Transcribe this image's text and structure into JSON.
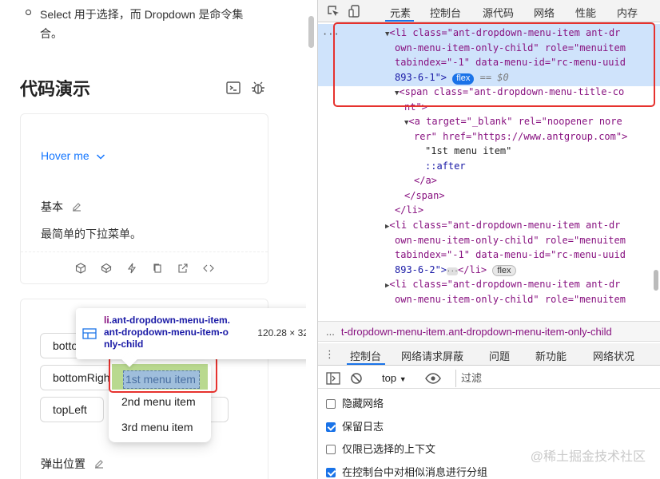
{
  "doc": {
    "bullet_line1": "Select 用于选择，而 Dropdown 是命令集",
    "bullet_line2": "合。",
    "section_title": "代码演示",
    "demo1": {
      "link_label": "Hover me",
      "title": "基本",
      "description": "最简单的下拉菜单。"
    },
    "demo2": {
      "buttons": [
        "bottomLeft",
        "bottomRight",
        "topLeft",
        "t"
      ],
      "section_label": "弹出位置"
    },
    "dropdown_items": [
      "1st menu item",
      "2nd menu item",
      "3rd menu item"
    ],
    "tooltip": {
      "tag": "li",
      "classes_line1": ".ant-dropdown-menu-item.",
      "classes_line2": "ant-dropdown-menu-item-o",
      "classes_line3": "nly-child",
      "size": "120.28 × 32"
    }
  },
  "devtools": {
    "tabs": [
      "元素",
      "控制台",
      "源代码",
      "网络",
      "性能",
      "内存"
    ],
    "active_tab": "元素",
    "code_lines": [
      "<li class=\"ant-dropdown-menu-item ant-dr",
      "own-menu-item-only-child\" role=\"menuitem",
      "tabindex=\"-1\" data-menu-id=\"rc-menu-uuid",
      "893-6-1\">",
      "<span class=\"ant-dropdown-menu-title-co",
      "nt\">",
      "<a target=\"_blank\" rel=\"noopener nore",
      "rer\" href=\"https://www.antgroup.com\">",
      "\"1st menu item\"",
      "::after",
      "</a>",
      "</span>",
      "</li>",
      "<li class=\"ant-dropdown-menu-item ant-dr",
      "own-menu-item-only-child\" role=\"menuitem",
      "tabindex=\"-1\" data-menu-id=\"rc-menu-uuid",
      "893-6-2\">",
      "</li>",
      "<li class=\"ant-dropdown-menu-item ant-dr",
      "own-menu-item-only-child\" role=\"menuitem"
    ],
    "badge_flex": "flex",
    "eq_var": "== $0",
    "breadcrumb": "t-dropdown-menu-item.ant-dropdown-menu-item-only-child",
    "breadcrumb_lead": "...",
    "drawer_tabs": [
      "控制台",
      "网络请求屏蔽",
      "问题",
      "新功能",
      "网络状况"
    ],
    "context": "top",
    "filter_placeholder": "过滤",
    "options": [
      {
        "label": "隐藏网络",
        "checked": false
      },
      {
        "label": "保留日志",
        "checked": true
      },
      {
        "label": "仅限已选择的上下文",
        "checked": false
      },
      {
        "label": "在控制台中对相似消息进行分组",
        "checked": true
      }
    ],
    "watermark": "@稀土掘金技术社区"
  },
  "colors": {
    "link_blue": "#1677ff",
    "tag_purple": "#881280",
    "attr_orange": "#994500",
    "value_blue": "#1a1aa6",
    "selection_blue": "#cfe3fb",
    "annotation_red": "#e6322e",
    "chrome_blue": "#1a73e8"
  }
}
